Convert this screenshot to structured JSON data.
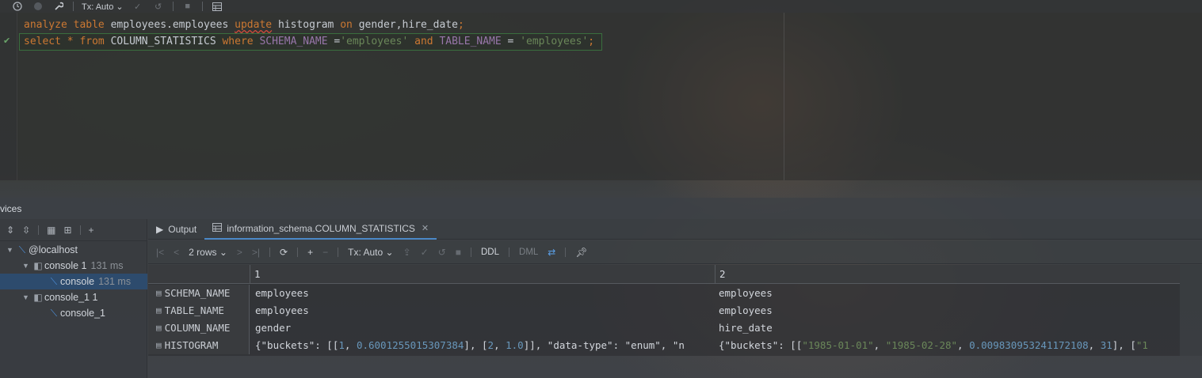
{
  "toolbar": {
    "tx_mode": "Tx: Auto"
  },
  "editor": {
    "line1": {
      "analyze": "analyze",
      "table": "table",
      "target": "employees.employees",
      "update": "update",
      "histogram": "histogram",
      "on": "on",
      "cols": "gender,hire_date",
      "semi": ";"
    },
    "line2": {
      "select": "select",
      "star": "*",
      "from": "from",
      "table": "COLUMN_STATISTICS",
      "where": "where",
      "col1": "SCHEMA_NAME",
      "eq1": " =",
      "val1": "'employees'",
      "and": "and",
      "col2": "TABLE_NAME",
      "eq2": " = ",
      "val2": "'employees'",
      "semi": ";"
    }
  },
  "services": {
    "title": "vices",
    "tree": [
      {
        "label": "@localhost",
        "meta": ""
      },
      {
        "label": "console 1",
        "meta": "131 ms"
      },
      {
        "label": "console",
        "meta": "131 ms"
      },
      {
        "label": "console_1 1",
        "meta": ""
      },
      {
        "label": "console_1",
        "meta": ""
      }
    ]
  },
  "results": {
    "tabs": [
      {
        "label": "Output"
      },
      {
        "label": "information_schema.COLUMN_STATISTICS"
      }
    ],
    "rows_selector": "2 rows",
    "tx_mode": "Tx: Auto",
    "ddl": "DDL",
    "dml": "DML",
    "columns": [
      "1",
      "2"
    ],
    "rows": [
      {
        "name": "SCHEMA_NAME",
        "c1": "employees",
        "c2": "employees"
      },
      {
        "name": "TABLE_NAME",
        "c1": "employees",
        "c2": "employees"
      },
      {
        "name": "COLUMN_NAME",
        "c1": "gender",
        "c2": "hire_date"
      }
    ],
    "histogram": {
      "name": "HISTOGRAM",
      "c1": {
        "p1": "{\"buckets\": [[",
        "n1": "1",
        "p2": ", ",
        "n2": "0.6001255015307384",
        "p3": "], [",
        "n3": "2",
        "p4": ", ",
        "n4": "1.0",
        "p5": "]], \"data-type\": \"enum\", \"n"
      },
      "c2": {
        "p1": "{\"buckets\": [[",
        "s1": "\"1985-01-01\"",
        "p2": ", ",
        "s2": "\"1985-02-28\"",
        "p3": ", ",
        "n1": "0.009830953241172108",
        "p4": ", ",
        "n2": "31",
        "p5": "], [",
        "s3": "\"1"
      }
    }
  }
}
